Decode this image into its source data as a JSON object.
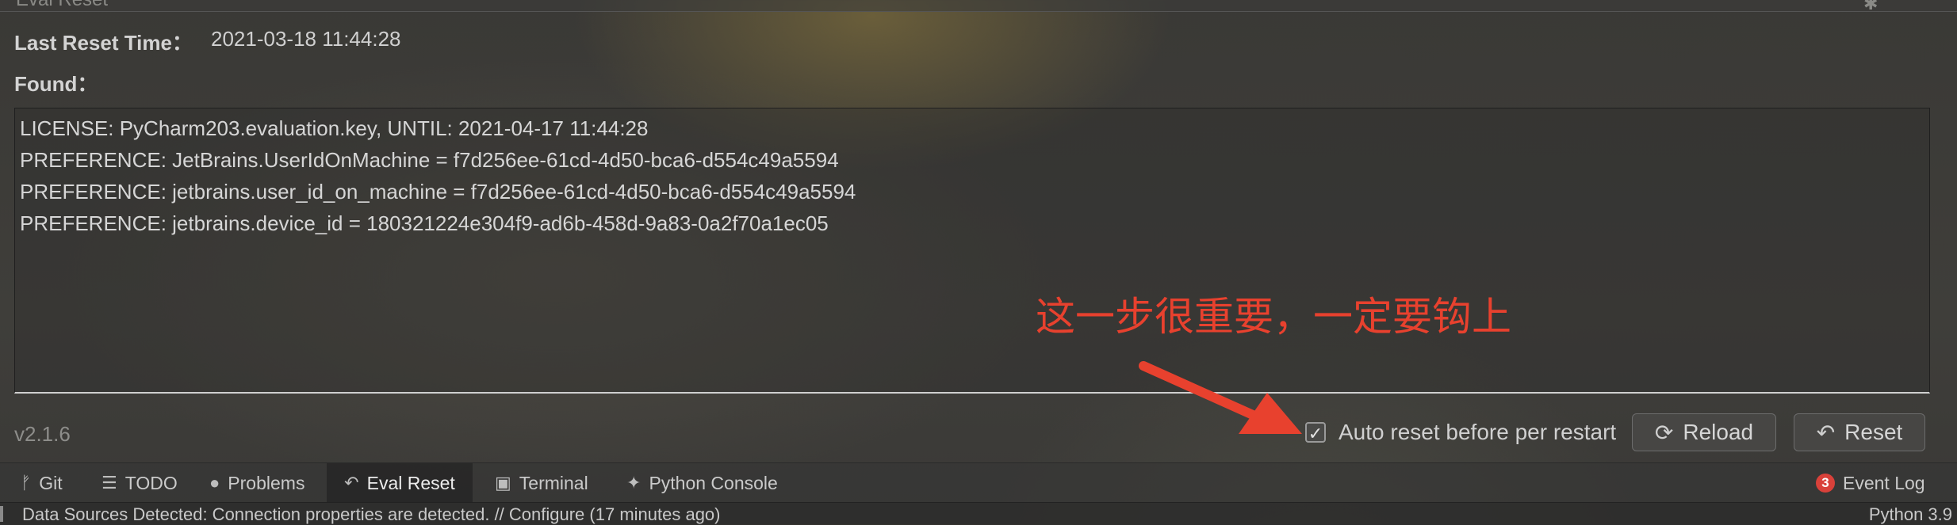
{
  "panel": {
    "title": "Eval Reset",
    "last_reset_label": "Last Reset Time：",
    "last_reset_value": "2021-03-18 11:44:28",
    "found_label": "Found："
  },
  "found_items": [
    "LICENSE: PyCharm203.evaluation.key, UNTIL: 2021-04-17 11:44:28",
    "PREFERENCE: JetBrains.UserIdOnMachine = f7d256ee-61cd-4d50-bca6-d554c49a5594",
    "PREFERENCE: jetbrains.user_id_on_machine = f7d256ee-61cd-4d50-bca6-d554c49a5594",
    "PREFERENCE: jetbrains.device_id = 180321224e304f9-ad6b-458d-9a83-0a2f70a1ec05"
  ],
  "version": "v2.1.6",
  "annotation": {
    "text": "这一步很重要，一定要钩上",
    "color": "#e8412e"
  },
  "controls": {
    "auto_reset_label": "Auto reset before per restart",
    "auto_reset_checked": true,
    "reload_label": "Reload",
    "reset_label": "Reset"
  },
  "tool_tabs": [
    {
      "label": "Git",
      "icon": "git-branch-icon"
    },
    {
      "label": "TODO",
      "icon": "list-icon"
    },
    {
      "label": "Problems",
      "icon": "info-icon"
    },
    {
      "label": "Eval Reset",
      "icon": "undo-icon",
      "active": true
    },
    {
      "label": "Terminal",
      "icon": "terminal-icon"
    },
    {
      "label": "Python Console",
      "icon": "python-icon"
    }
  ],
  "event_log": {
    "label": "Event Log",
    "count": "3"
  },
  "status_bar": {
    "message": "Data Sources Detected: Connection properties are detected. // Configure (17 minutes ago)",
    "interpreter": "Python 3.9"
  }
}
